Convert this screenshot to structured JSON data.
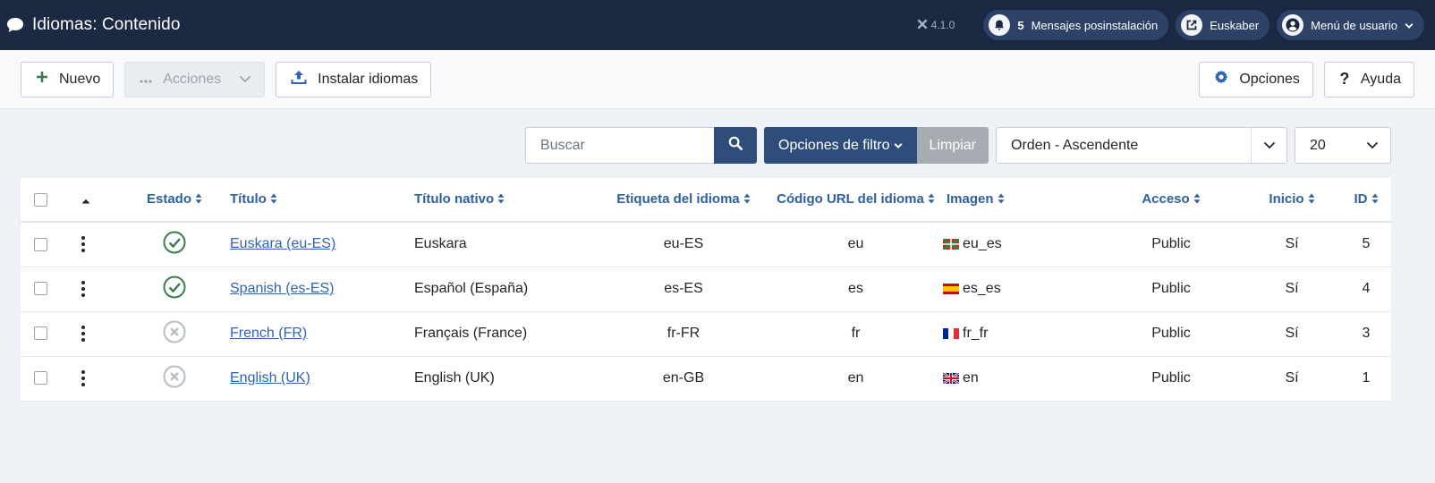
{
  "header": {
    "title": "Idiomas: Contenido",
    "version": "4.1.0",
    "notifications": {
      "count": "5",
      "label": "Mensajes posinstalación"
    },
    "site_label": "Euskaber",
    "user_menu_label": "Menú de usuario"
  },
  "toolbar": {
    "new_label": "Nuevo",
    "actions_label": "Acciones",
    "install_label": "Instalar idiomas",
    "options_label": "Opciones",
    "help_label": "Ayuda"
  },
  "filters": {
    "search_placeholder": "Buscar",
    "filter_options_label": "Opciones de filtro",
    "clear_label": "Limpiar",
    "order_value": "Orden - Ascendente",
    "limit_value": "20"
  },
  "table": {
    "columns": {
      "estado": "Estado",
      "titulo": "Título",
      "titulo_nativo": "Título nativo",
      "etiqueta": "Etiqueta del idioma",
      "codigo": "Código URL del idioma",
      "imagen": "Imagen",
      "acceso": "Acceso",
      "inicio": "Inicio",
      "id": "ID"
    },
    "rows": [
      {
        "status": "published",
        "title": "Euskara (eu-ES)",
        "native": "Euskara",
        "tag": "eu-ES",
        "code": "eu",
        "flag": "basque-flag",
        "image": "eu_es",
        "access": "Public",
        "home": "Sí",
        "id": "5"
      },
      {
        "status": "published",
        "title": "Spanish (es-ES)",
        "native": "Español (España)",
        "tag": "es-ES",
        "code": "es",
        "flag": "spanish-flag",
        "image": "es_es",
        "access": "Public",
        "home": "Sí",
        "id": "4"
      },
      {
        "status": "unpublished",
        "title": "French (FR)",
        "native": "Français (France)",
        "tag": "fr-FR",
        "code": "fr",
        "flag": "french-flag",
        "image": "fr_fr",
        "access": "Public",
        "home": "Sí",
        "id": "3"
      },
      {
        "status": "unpublished",
        "title": "English (UK)",
        "native": "English (UK)",
        "tag": "en-GB",
        "code": "en",
        "flag": "uk-flag",
        "image": "en",
        "access": "Public",
        "home": "Sí",
        "id": "1"
      }
    ]
  },
  "colors": {
    "header_bg": "#1c2942",
    "primary": "#2e4d7b",
    "link": "#2e64b0",
    "published": "#3a7d4c",
    "unpublished": "#b9bec4"
  }
}
